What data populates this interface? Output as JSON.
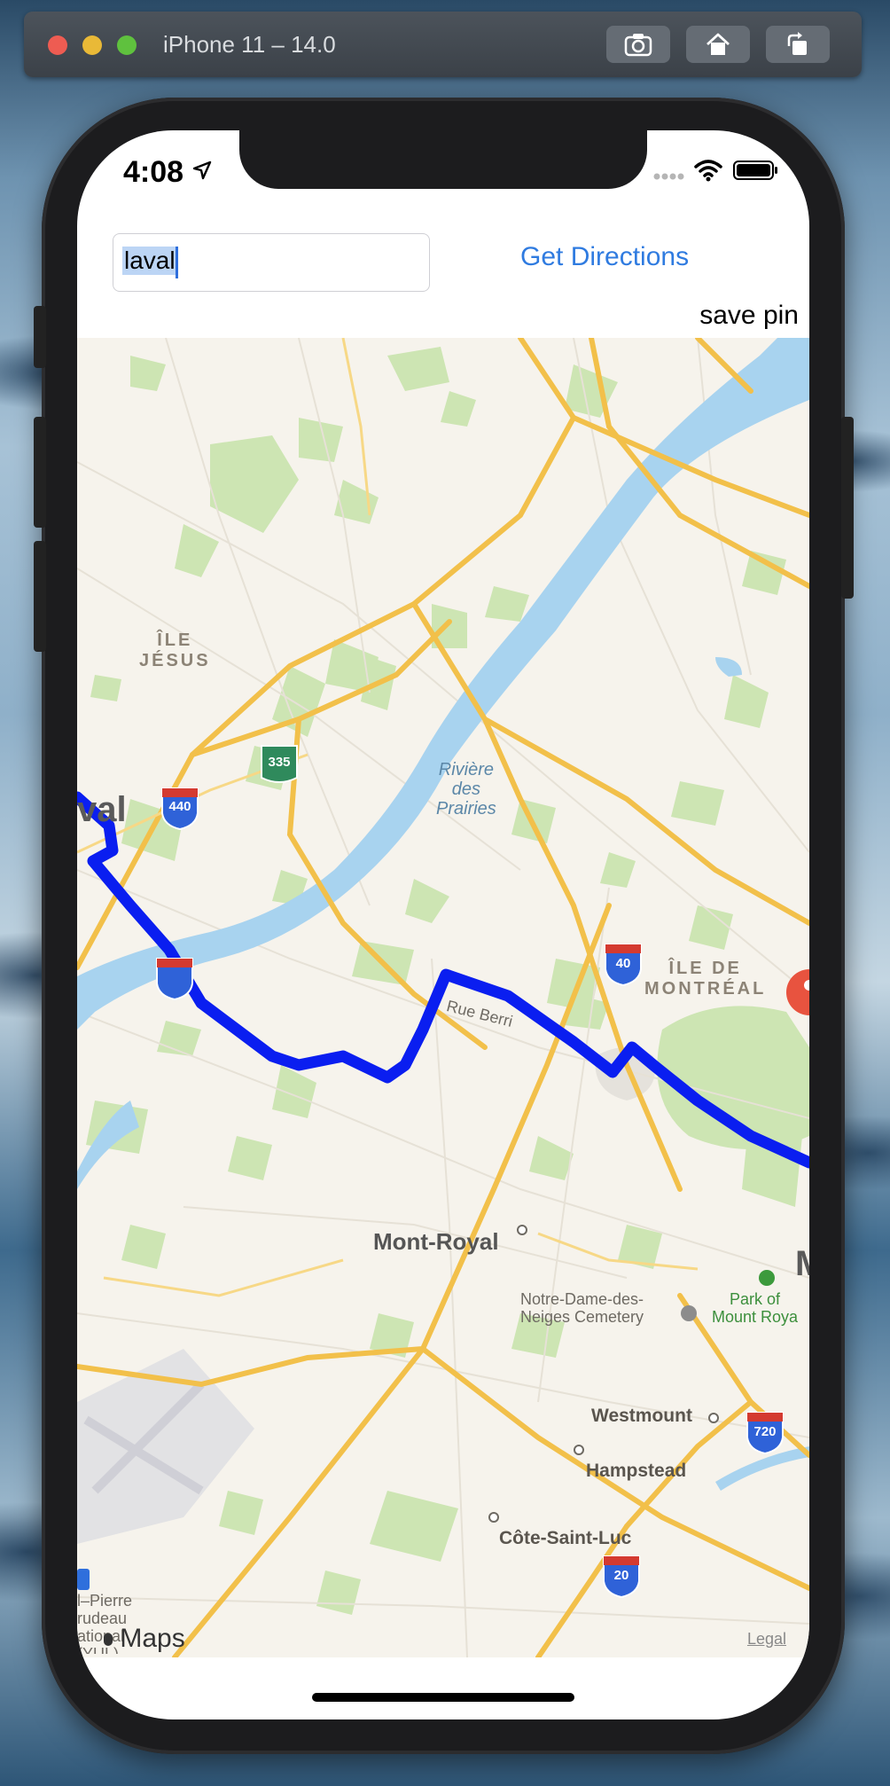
{
  "simulator": {
    "title": "iPhone 11 – 14.0",
    "buttons": [
      "screenshot-icon",
      "home-icon",
      "rotate-icon"
    ]
  },
  "status_bar": {
    "time": "4:08"
  },
  "app": {
    "search_value": "laval",
    "get_directions_label": "Get Directions",
    "save_pin_label": "save pin"
  },
  "map": {
    "regions": {
      "ile_jesus_line1": "ÎLE",
      "ile_jesus_line2": "JÉSUS",
      "ile_montreal_line1": "ÎLE DE",
      "ile_montreal_line2": "MONTRÉAL"
    },
    "cities": {
      "laval_partial": "val",
      "mont_royal": "Mont-Royal",
      "montreal_partial": "M"
    },
    "water": {
      "river_line1": "Rivière",
      "river_line2": "des",
      "river_line3": "Prairies"
    },
    "streets": {
      "rue_berri": "Rue Berri"
    },
    "pois": {
      "cemetery_line1": "Notre-Dame-des-",
      "cemetery_line2": "Neiges Cemetery",
      "park_line1": "Park of",
      "park_line2": "Mount Roya"
    },
    "towns": {
      "westmount": "Westmount",
      "hampstead": "Hampstead",
      "cote_saint_luc": "Côte-Saint-Luc"
    },
    "airport": {
      "line1": "l–Pierre",
      "line2": "rudeau",
      "line3": "ational",
      "line4": "(YUL)"
    },
    "shields": {
      "r335": "335",
      "i440": "440",
      "i40": "40",
      "i720": "720",
      "i20": "20"
    },
    "maps_logo": "Maps",
    "legal": "Legal",
    "route_color": "#0a1ef0"
  }
}
